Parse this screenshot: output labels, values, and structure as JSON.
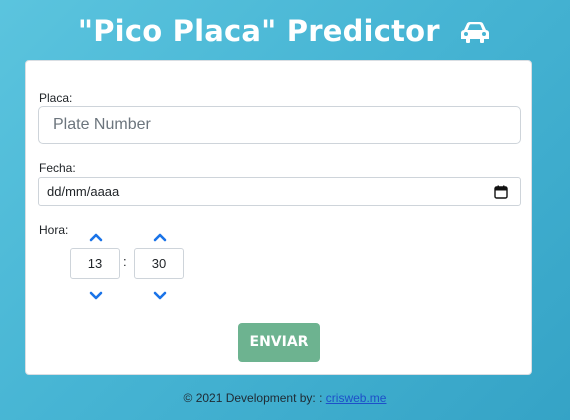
{
  "header": {
    "title": "\"Pico Placa\" Predictor",
    "icon": "car-icon"
  },
  "form": {
    "plate": {
      "label": "Placa:",
      "placeholder": "Plate Number",
      "value": ""
    },
    "date": {
      "label": "Fecha:",
      "placeholder": "dd/mm/aaaa",
      "icon": "calendar-icon"
    },
    "time": {
      "label": "Hora:",
      "hour": "13",
      "separator": ":",
      "minute": "30"
    },
    "submit_label": "ENVIAR"
  },
  "footer": {
    "text": "© 2021 Development by: :",
    "link_text": "crisweb.me"
  },
  "colors": {
    "accent": "#1a73e8",
    "button": "#6db390",
    "background": "#47b5d4"
  }
}
